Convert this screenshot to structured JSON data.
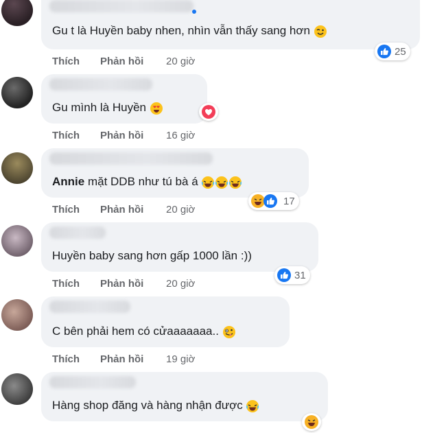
{
  "comments": [
    {
      "text": "Gu t là Huyền baby nhen, nhìn vẫn thấy sang hơn",
      "actions": {
        "like": "Thích",
        "reply": "Phản hồi"
      },
      "time": "20 giờ",
      "reaction_count": "25",
      "reactions": [
        "like"
      ],
      "emoji_icon": "wink-smile-emoji"
    },
    {
      "text": "Gu mình là Huyền",
      "actions": {
        "like": "Thích",
        "reply": "Phản hồi"
      },
      "time": "16 giờ",
      "reaction_count": "",
      "reactions": [
        "love"
      ],
      "emoji_icon": "heart-eyes-emoji"
    },
    {
      "mention": "Annie",
      "text": "mặt DDB như tú bà á",
      "actions": {
        "like": "Thích",
        "reply": "Phản hồi"
      },
      "time": "20 giờ",
      "reaction_count": "17",
      "reactions": [
        "haha",
        "like"
      ],
      "emoji_icon": "rolling-laugh-emoji"
    },
    {
      "text": "Huyền baby sang hơn gấp 1000 lần :))",
      "actions": {
        "like": "Thích",
        "reply": "Phản hồi"
      },
      "time": "20 giờ",
      "reaction_count": "31",
      "reactions": [
        "like"
      ]
    },
    {
      "text": "C bên phải hem có cửaaaaaaa..",
      "actions": {
        "like": "Thích",
        "reply": "Phản hồi"
      },
      "time": "19 giờ",
      "reactions": [],
      "emoji_icon": "zany-face-emoji"
    },
    {
      "text": "Hàng shop đăng và hàng nhận được",
      "reactions": [
        "haha"
      ],
      "emoji_icon": "rolling-laugh-emoji"
    }
  ],
  "colors": {
    "bubble": "#f0f2f5",
    "meta_text": "#65676b",
    "like_blue": "#1877f2",
    "love_red": "#f33e58",
    "haha_yellow": "#f7b125"
  }
}
